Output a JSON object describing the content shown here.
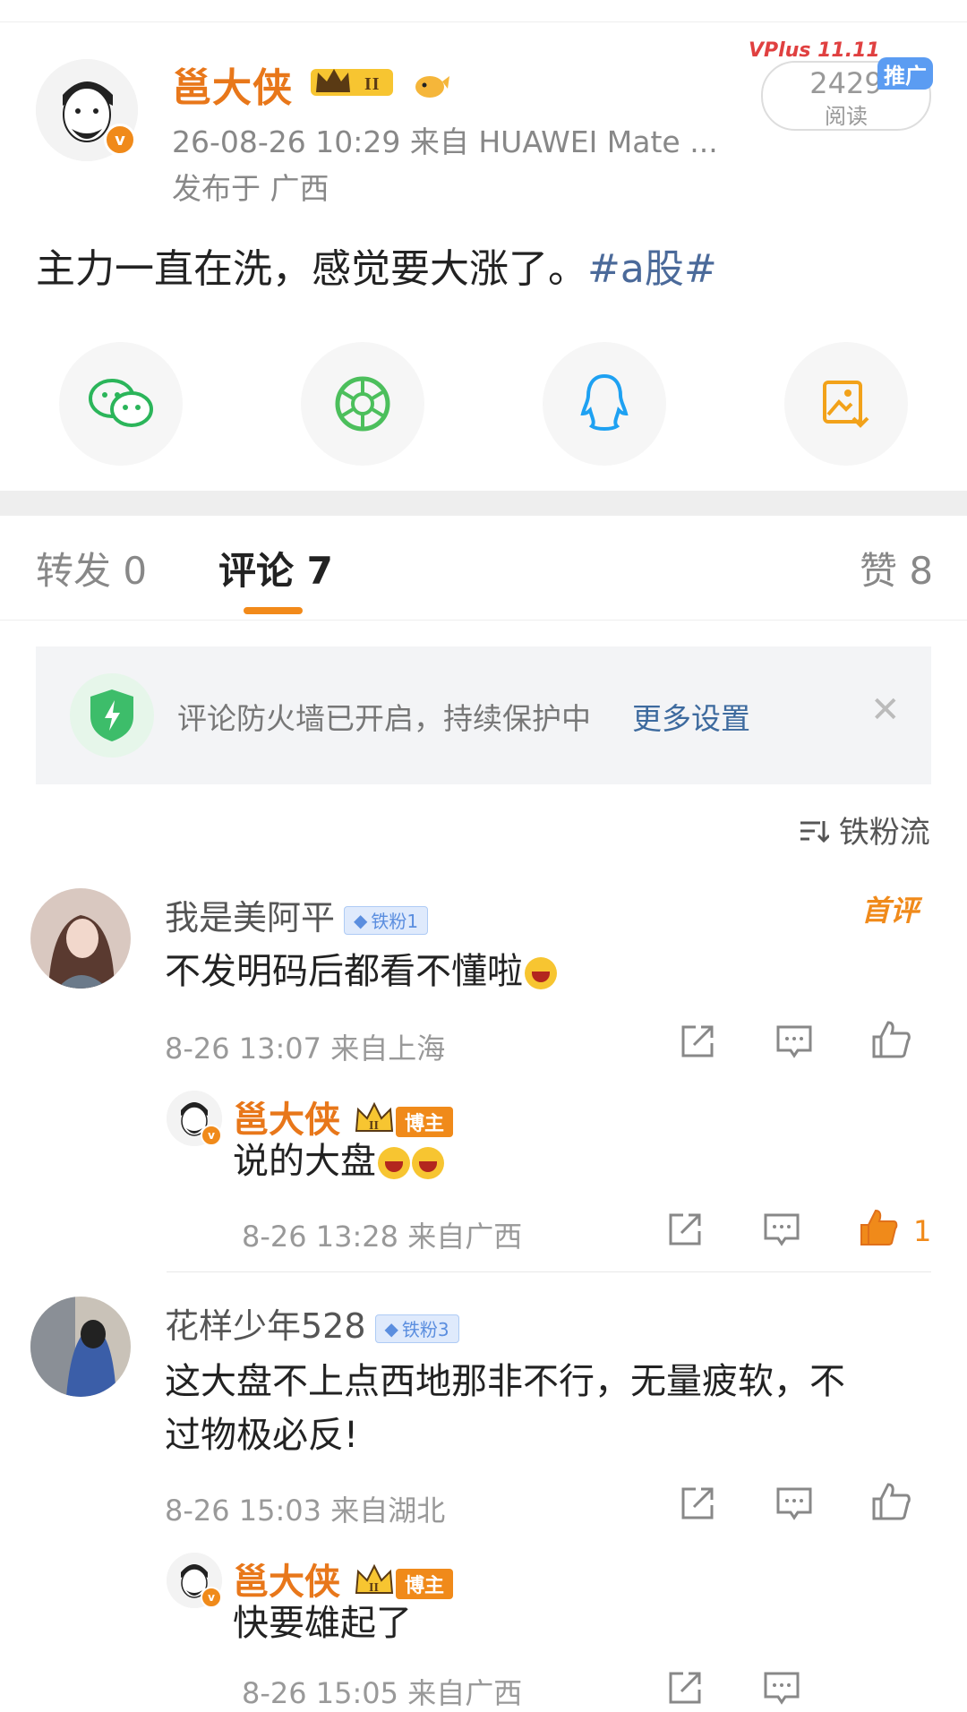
{
  "post": {
    "author": "邕大侠",
    "time_source": "26-08-26 10:29  来自 HUAWEI Mate ...",
    "location": "发布于 广西",
    "text": "主力一直在洗，感觉要大涨了。",
    "tag": "#a股#",
    "read_count": "2429",
    "read_label": "阅读",
    "promo_label": "推广",
    "vplus_label": "VPlus 11.11"
  },
  "share": {
    "icons": [
      "wechat-icon",
      "moments-icon",
      "qq-icon",
      "save-image-icon"
    ],
    "colors": {
      "wechat": "#2bb55a",
      "moments": "#4cbf5c",
      "qq": "#1ea1f2",
      "save": "#f2a21a"
    }
  },
  "tabs": {
    "repost": "转发 0",
    "comment": "评论 7",
    "like": "赞 8"
  },
  "firewall": {
    "text": "评论防火墙已开启，持续保护中",
    "link": "更多设置"
  },
  "sort_label": "铁粉流",
  "comments": [
    {
      "name": "我是美阿平",
      "fan_badge": "铁粉1",
      "first_label": "首评",
      "text": "不发明码后都看不懂啦",
      "time": "8-26 13:07 来自上海",
      "reply": {
        "name": "邕大侠",
        "badge": "博主",
        "text": "说的大盘",
        "time": "8-26 13:28 来自广西",
        "likes": "1"
      }
    },
    {
      "name": "花样少年528",
      "fan_badge": "铁粉3",
      "text_line1": "这大盘不上点西地那非不行，无量疲软，不",
      "text_line2": "过物极必反!",
      "time": "8-26 15:03 来自湖北",
      "reply": {
        "name": "邕大侠",
        "badge": "博主",
        "text": "快要雄起了",
        "time": "8-26 15:05 来自广西"
      }
    }
  ],
  "accent_color": "#f08a1a",
  "link_color": "#3d6a9e"
}
